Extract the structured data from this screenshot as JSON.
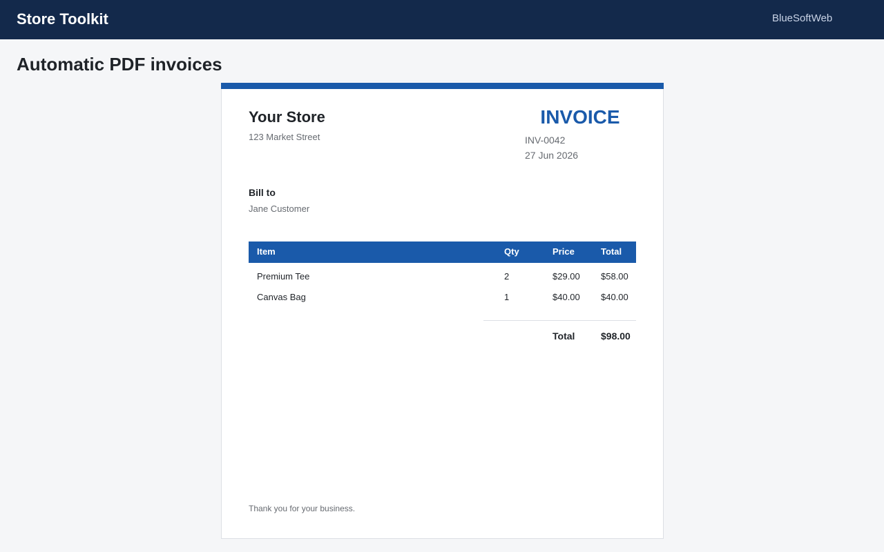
{
  "header": {
    "brand": "Store Toolkit",
    "vendor": "BlueSoftWeb"
  },
  "page": {
    "title": "Automatic PDF invoices"
  },
  "invoice": {
    "accent_color": "#1a5aaa",
    "store_name": "Your Store",
    "store_address": "123 Market Street",
    "heading": "INVOICE",
    "number": "INV-0042",
    "date": "27 Jun 2026",
    "bill_to_label": "Bill to",
    "bill_to_name": "Jane Customer",
    "columns": [
      "Item",
      "Qty",
      "Price",
      "Total"
    ],
    "rows": [
      {
        "item": "Premium Tee",
        "qty": "2",
        "price": "$29.00",
        "total": "$58.00"
      },
      {
        "item": "Canvas Bag",
        "qty": "1",
        "price": "$40.00",
        "total": "$40.00"
      }
    ],
    "total_label": "Total",
    "total_value": "$98.00",
    "footer_note": "Thank you for your business."
  }
}
